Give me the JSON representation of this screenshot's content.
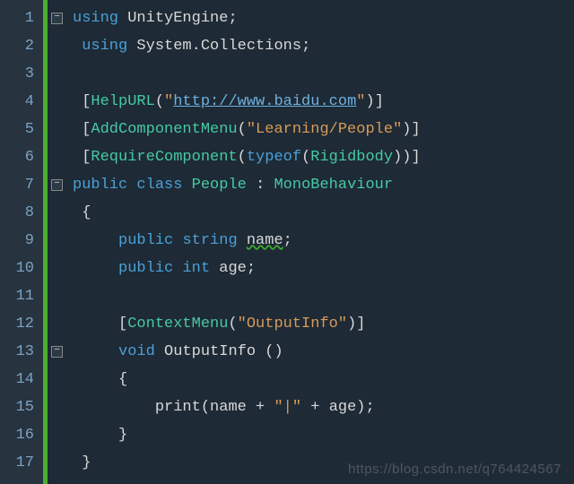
{
  "lines": [
    "1",
    "2",
    "3",
    "4",
    "5",
    "6",
    "7",
    "8",
    "9",
    "10",
    "11",
    "12",
    "13",
    "14",
    "15",
    "16",
    "17"
  ],
  "code": {
    "l1": {
      "kw1": "using",
      "ns": "UnityEngine",
      "semi": ";"
    },
    "l2": {
      "kw1": "using",
      "ns": "System.Collections",
      "semi": ";"
    },
    "l4": {
      "ob": "[",
      "attr": "HelpURL",
      "op": "(",
      "q1": "\"",
      "url": "http://www.baidu.com",
      "q2": "\"",
      "cp": ")",
      "cb": "]"
    },
    "l5": {
      "ob": "[",
      "attr": "AddComponentMenu",
      "op": "(",
      "str": "\"Learning/People\"",
      "cp": ")",
      "cb": "]"
    },
    "l6": {
      "ob": "[",
      "attr": "RequireComponent",
      "op": "(",
      "to": "typeof",
      "op2": "(",
      "type": "Rigidbody",
      "cp2": ")",
      "cp": ")",
      "cb": "]"
    },
    "l7": {
      "acc": "public",
      "cls": "class",
      "name": "People",
      "colon": ":",
      "base": "MonoBehaviour"
    },
    "l8": {
      "brace": "{"
    },
    "l9": {
      "acc": "public",
      "type": "string",
      "name": "name",
      "semi": ";"
    },
    "l10": {
      "acc": "public",
      "type": "int",
      "name": "age",
      "semi": ";"
    },
    "l12": {
      "ob": "[",
      "attr": "ContextMenu",
      "op": "(",
      "str": "\"OutputInfo\"",
      "cp": ")",
      "cb": "]"
    },
    "l13": {
      "ret": "void",
      "name": "OutputInfo",
      "paren": "()"
    },
    "l14": {
      "brace": "{"
    },
    "l15": {
      "fn": "print",
      "op": "(",
      "a1": "name",
      "plus1": " + ",
      "s": "\"|\"",
      "plus2": " + ",
      "a2": "age",
      "cp": ")",
      "semi": ";"
    },
    "l16": {
      "brace": "}"
    },
    "l17": {
      "brace": "}"
    }
  },
  "watermark": "https://blog.csdn.net/q764424567"
}
